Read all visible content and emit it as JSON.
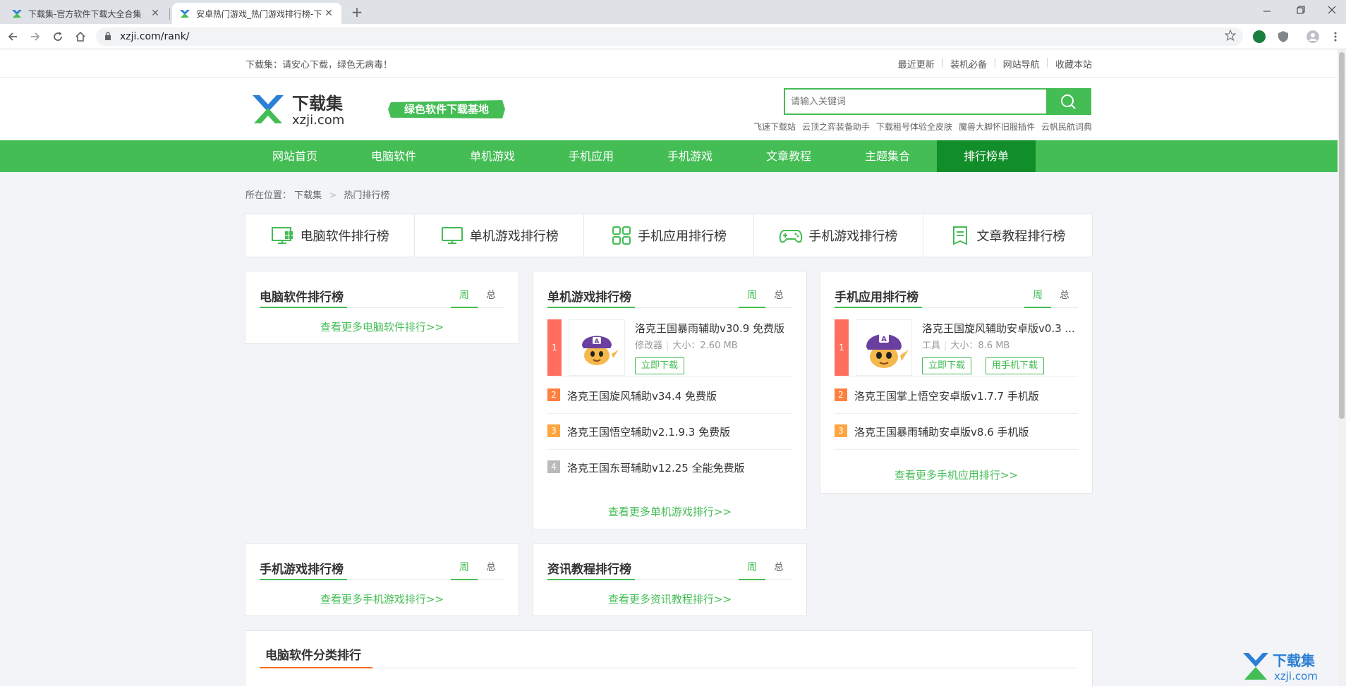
{
  "browser": {
    "tabs": [
      {
        "title": "下载集-官方软件下载大全合集",
        "close": "✕"
      },
      {
        "title": "安卓热门游戏_热门游戏排行榜-下",
        "close": "✕"
      }
    ],
    "new_tab": "+",
    "url": "xzji.com/rank/"
  },
  "topbar": {
    "slogan": "下载集：请安心下载，绿色无病毒！",
    "links": [
      "最近更新",
      "装机必备",
      "网站导航",
      "收藏本站"
    ]
  },
  "header": {
    "logo_cn": "下载集",
    "logo_en": "xzji.com",
    "badge": "绿色软件下载基地",
    "search_placeholder": "请输入关键词",
    "hotwords": [
      "飞速下载站",
      "云顶之弈装备助手",
      "下载租号体验全皮肤",
      "魔兽大脚怀旧服插件",
      "云帆民航词典"
    ]
  },
  "nav": [
    "网站首页",
    "电脑软件",
    "单机游戏",
    "手机应用",
    "手机游戏",
    "文章教程",
    "主题集合",
    "排行榜单"
  ],
  "breadcrumb": {
    "prefix": "所在位置：",
    "items": [
      "下载集",
      "热门排行榜"
    ],
    "sep": ">"
  },
  "rank_tabs": [
    "电脑软件排行榜",
    "单机游戏排行榜",
    "手机应用排行榜",
    "手机游戏排行榜",
    "文章教程排行榜"
  ],
  "switch": {
    "week": "周",
    "total": "总"
  },
  "cards": {
    "pc": {
      "title": "电脑软件排行榜",
      "more": "查看更多电脑软件排行>>"
    },
    "single": {
      "title": "单机游戏排行榜",
      "top": {
        "rank": "1",
        "name": "洛克王国暴雨辅助v30.9 免费版",
        "category": "修改器",
        "size": "大小：2.60 MB",
        "download": "立即下载"
      },
      "rows": [
        {
          "rank": "2",
          "name": "洛克王国旋风辅助v34.4 免费版"
        },
        {
          "rank": "3",
          "name": "洛克王国悟空辅助v2.1.9.3 免费版"
        },
        {
          "rank": "4",
          "name": "洛克王国东哥辅助v12.25 全能免费版"
        }
      ],
      "more": "查看更多单机游戏排行>>"
    },
    "app": {
      "title": "手机应用排行榜",
      "top": {
        "rank": "1",
        "name": "洛克王国旋风辅助安卓版v0.3 ...",
        "category": "工具",
        "size": "大小：8.6 MB",
        "download": "立即下载",
        "mobile": "用手机下载"
      },
      "rows": [
        {
          "rank": "2",
          "name": "洛克王国掌上悟空安卓版v1.7.7 手机版"
        },
        {
          "rank": "3",
          "name": "洛克王国暴雨辅助安卓版v8.6 手机版"
        }
      ],
      "more": "查看更多手机应用排行>>"
    },
    "mgame": {
      "title": "手机游戏排行榜",
      "more": "查看更多手机游戏排行>>"
    },
    "news": {
      "title": "资讯教程排行榜",
      "more": "查看更多资讯教程排行>>"
    }
  },
  "category_section": {
    "title": "电脑软件分类排行"
  },
  "watermark": {
    "cn": "下载集",
    "en": "xzji.com"
  },
  "colors": {
    "brand": "#44bd55",
    "nav_active": "#118d2a",
    "rank1": "#ff6e5e",
    "rank2": "#ff7f3f",
    "rank3": "#ffa53f",
    "rank4": "#bbbbbb",
    "accent": "#ff6b1a"
  }
}
